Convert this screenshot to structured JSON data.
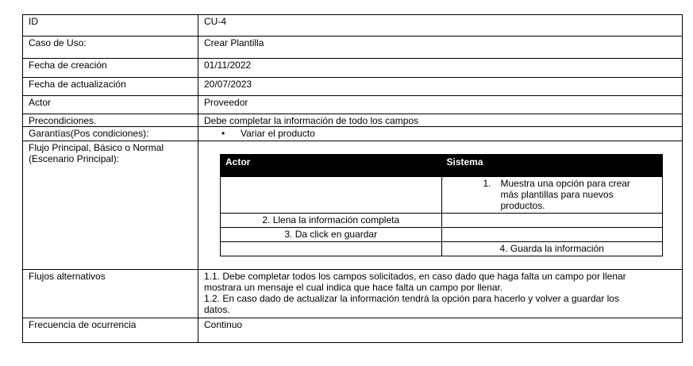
{
  "rows": {
    "id": {
      "label": "ID",
      "value": "CU-4"
    },
    "caso": {
      "label": "Caso de Uso:",
      "value": "Crear Plantilla"
    },
    "fecha_creacion": {
      "label": "Fecha de creación",
      "value": "01/11/2022"
    },
    "fecha_actualizacion": {
      "label": "Fecha de actualización",
      "value": "20/07/2023"
    },
    "actor": {
      "label": "Actor",
      "value": "Proveedor"
    },
    "precondiciones": {
      "label": "Precondiciones.",
      "value": "Debe completar la información de todo los campos"
    },
    "garantias": {
      "label": "Garantías(Pos condiciones):",
      "bullet": "•",
      "value": "Variar el producto"
    },
    "flujo": {
      "label_line1": "Flujo Principal, Básico o Normal",
      "label_line2": "(Escenario Principal):"
    },
    "alternativos": {
      "label": "Flujos alternativos",
      "line1": "1.1. Debe completar todos los campos solicitados, en caso dado que haga falta un campo por llenar",
      "line2": "mostrara un mensaje el cual indica que hace falta un campo por llenar.",
      "line3": "1.2. En caso dado de actualizar la información tendrá la opción para hacerlo y volver a guardar los",
      "line4": "datos."
    },
    "frecuencia": {
      "label": "Frecuencia de ocurrencia",
      "value": "Continuo"
    }
  },
  "flow_table": {
    "headers": {
      "actor": "Actor",
      "sistema": "Sistema"
    },
    "step1": {
      "num": "1.",
      "line1": "Muestra una opción para crear",
      "line2": "más plantillas para nuevos",
      "line3": "productos."
    },
    "step2": "2. Llena la información completa",
    "step3": "3. Da click en guardar",
    "step4": "4. Guarda la información"
  }
}
